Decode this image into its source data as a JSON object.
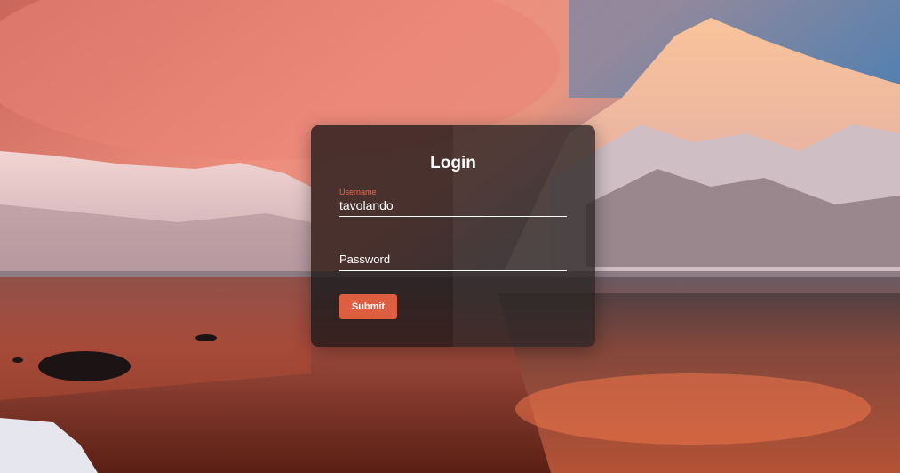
{
  "background": {
    "scene": "mountain-lake-sunset",
    "sky_color": "#e8846f",
    "sky_blue": "#4d7fb3",
    "snow_color": "#f3e6e8",
    "water_color": "#b8452f"
  },
  "login": {
    "title": "Login",
    "username": {
      "label": "Username",
      "value": "tavolando"
    },
    "password": {
      "placeholder": "Password",
      "value": ""
    },
    "submit_label": "Submit",
    "accent_color": "#dd5e40"
  }
}
